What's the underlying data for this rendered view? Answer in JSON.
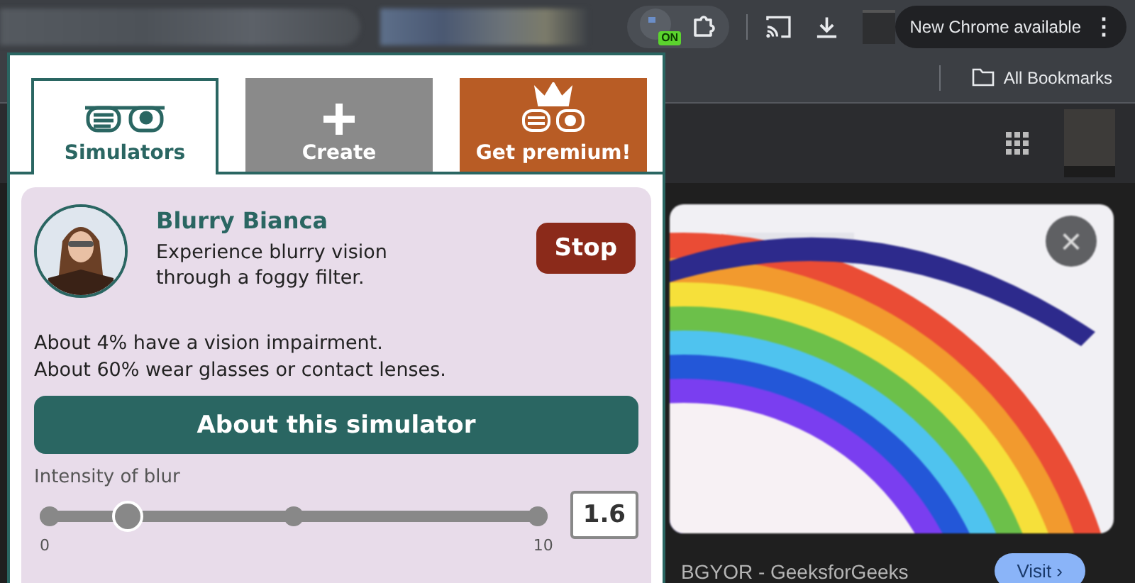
{
  "browser": {
    "extension_badge": "ON",
    "update_button": "New Chrome available",
    "menu_glyph": "⋮",
    "bookmarks": [
      {
        "label": "All Bookmarks"
      }
    ]
  },
  "popup": {
    "tabs": [
      {
        "label": "Simulators",
        "selected": true,
        "kind": "glasses"
      },
      {
        "label": "Create",
        "selected": false,
        "kind": "plus"
      },
      {
        "label": "Get premium!",
        "selected": false,
        "kind": "crown"
      }
    ],
    "simulator": {
      "name": "Blurry Bianca",
      "description": "Experience blurry vision through a foggy filter.",
      "stop_button": "Stop",
      "facts": [
        "About 4% have a vision impairment.",
        "About 60% wear glasses or contact lenses."
      ],
      "about_button": "About this simulator",
      "slider": {
        "label": "Intensity of blur",
        "level": 0.16,
        "min_label": "0",
        "max_label": "10",
        "value": "1.6"
      }
    }
  },
  "page": {
    "close_glyph": "×",
    "caption": "BGYOR - GeeksforGeeks",
    "visit_button": "Visit ›"
  }
}
